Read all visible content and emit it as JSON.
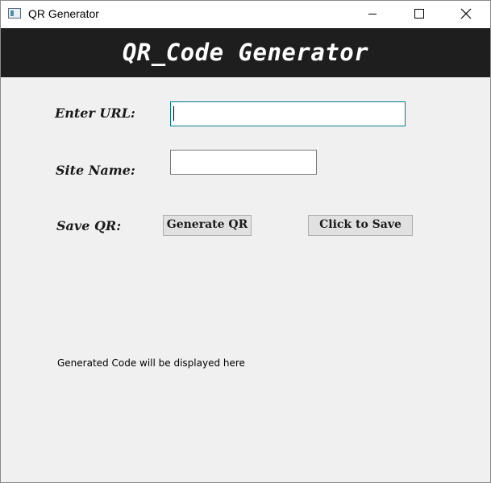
{
  "window": {
    "title": "QR Generator",
    "app_icon": "window-app-icon",
    "controls": {
      "minimize": "minimize-icon",
      "maximize": "maximize-icon",
      "close": "close-icon"
    }
  },
  "header": {
    "title": "QR_Code Generator",
    "background": "#1e1e1e",
    "color": "#ffffff"
  },
  "form": {
    "url_label": "Enter URL:",
    "url_value": "",
    "site_name_label": "Site Name:",
    "site_name_value": "",
    "save_label": "Save QR:",
    "generate_button": "Generate QR",
    "save_button": "Click to Save"
  },
  "status": {
    "text": "Generated Code will be displayed here"
  }
}
